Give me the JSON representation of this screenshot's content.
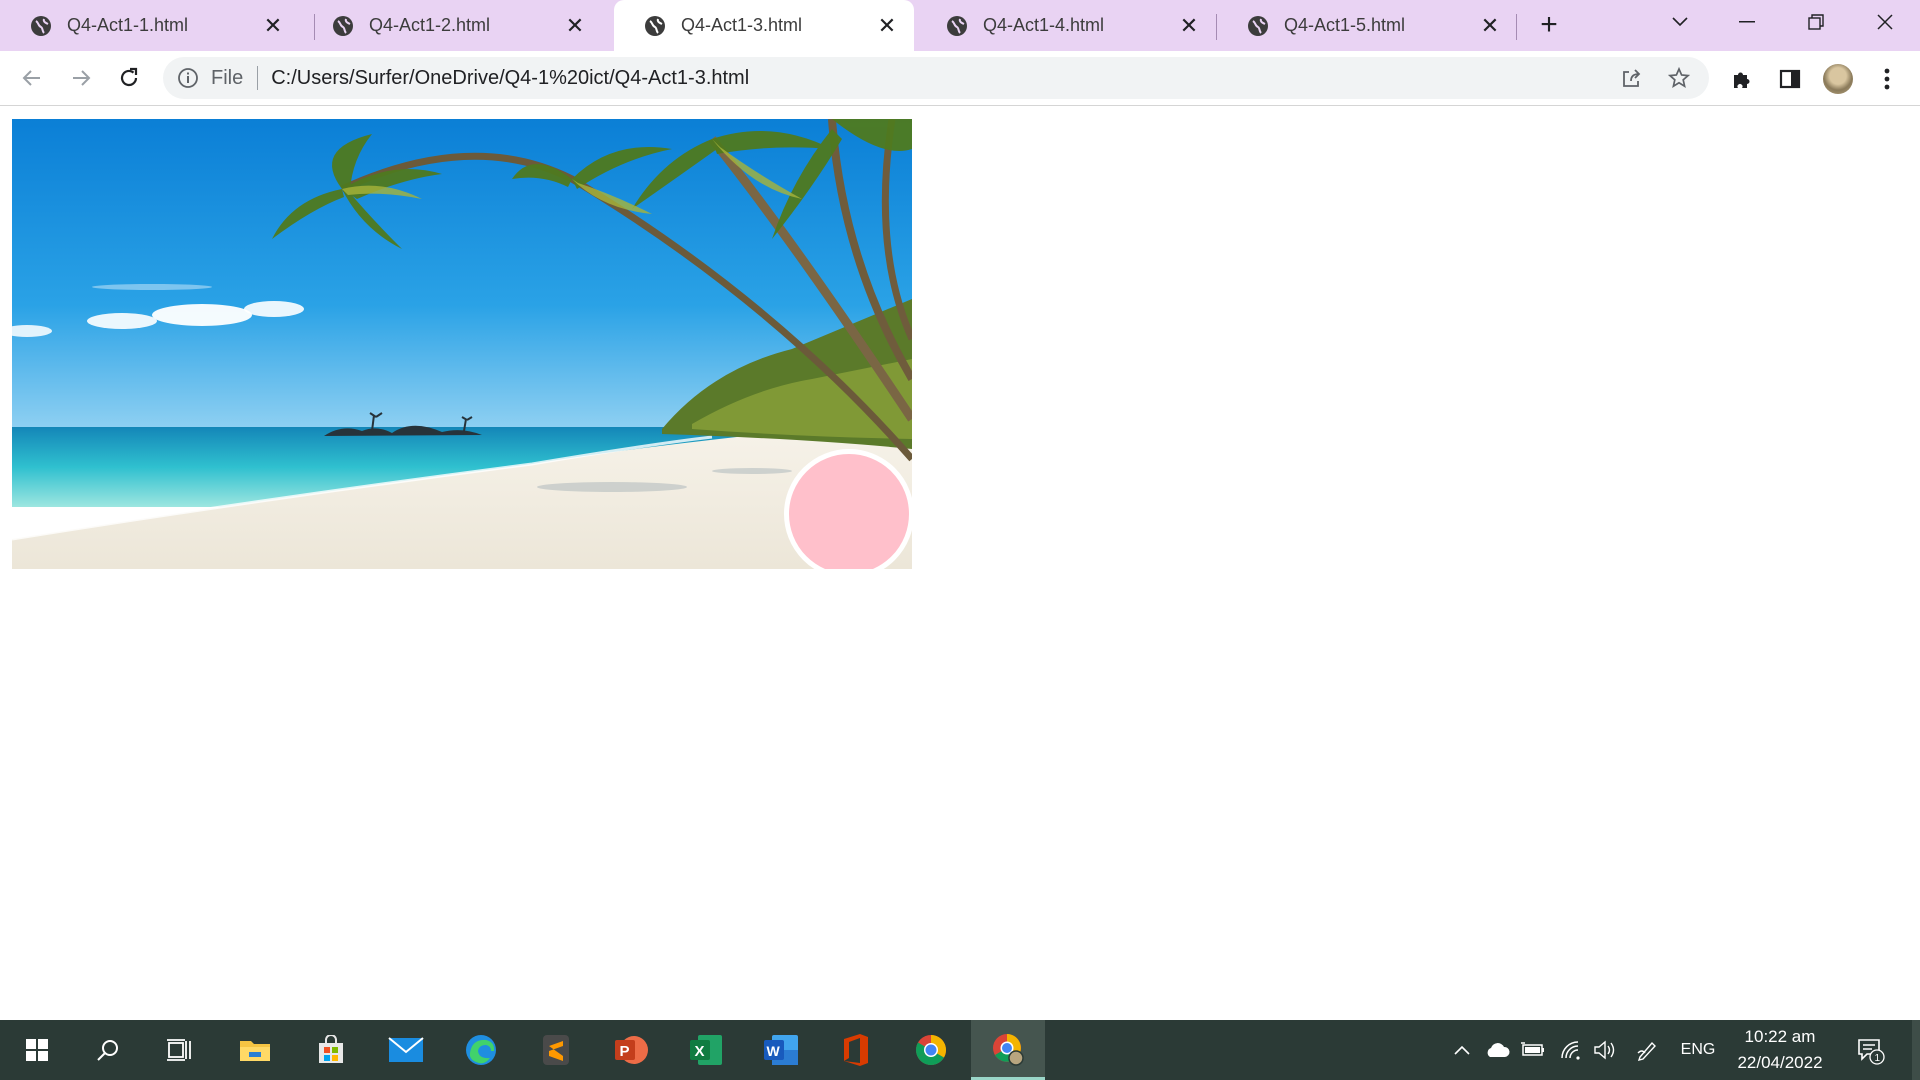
{
  "tabs": [
    {
      "title": "Q4-Act1-1.html",
      "active": false
    },
    {
      "title": "Q4-Act1-2.html",
      "active": false
    },
    {
      "title": "Q4-Act1-3.html",
      "active": true
    },
    {
      "title": "Q4-Act1-4.html",
      "active": false
    },
    {
      "title": "Q4-Act1-5.html",
      "active": false
    }
  ],
  "toolbar": {
    "scheme_label": "File",
    "url": "C:/Users/Surfer/OneDrive/Q4-1%20ict/Q4-Act1-3.html"
  },
  "page": {
    "image_subject": "tropical beach with palm trees",
    "circle_color": "#ffc0cb"
  },
  "taskbar": {
    "apps": [
      "start-icon",
      "search-icon",
      "task-view-icon",
      "file-explorer-icon",
      "microsoft-store-icon",
      "mail-icon",
      "edge-icon",
      "sublime-text-icon",
      "powerpoint-icon",
      "excel-icon",
      "word-icon",
      "office-icon",
      "chrome-icon",
      "chrome-profile-icon"
    ],
    "language": "ENG",
    "time": "10:22 am",
    "date": "22/04/2022",
    "notification_count": "1"
  },
  "colors": {
    "tabstrip": "#e9d3f3",
    "taskbar": "#2b3a36"
  }
}
